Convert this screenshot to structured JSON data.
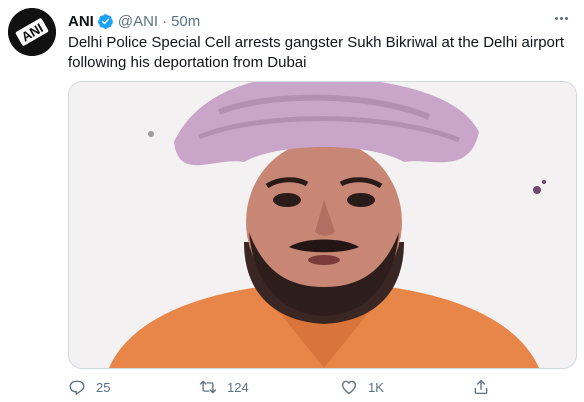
{
  "tweet": {
    "author_name": "ANI",
    "handle": "@ANI",
    "separator": "·",
    "time": "50m",
    "text": "Delhi Police Special Cell arrests gangster Sukh Bikriwal at the Delhi airport following his deportation from Dubai",
    "avatar_logo_text": "ANI",
    "verified": true,
    "media_description_icon": "photo-of-man-in-turban"
  },
  "actions": {
    "reply_count": "25",
    "retweet_count": "124",
    "like_count": "1K"
  },
  "colors": {
    "verified_blue": "#1da1f2",
    "secondary_text": "#5b7083",
    "primary_text": "#0f1419",
    "turban_lilac": "#c9a6c9",
    "shirt_orange": "#e8864a"
  }
}
